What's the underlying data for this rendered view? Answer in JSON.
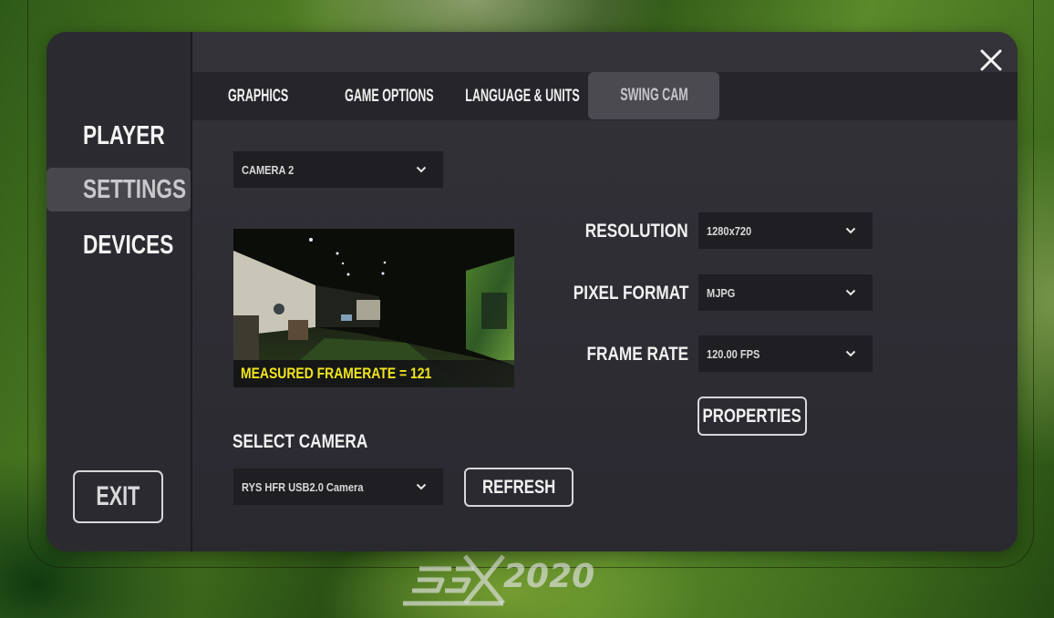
{
  "window": {
    "app_logo_text": "2020",
    "close_icon": "close-icon"
  },
  "sidebar": {
    "items": [
      {
        "label": "PLAYER",
        "active": false
      },
      {
        "label": "SETTINGS",
        "active": true
      },
      {
        "label": "DEVICES",
        "active": false
      }
    ],
    "exit_label": "EXIT"
  },
  "tabs": [
    {
      "label": "GRAPHICS",
      "active": false
    },
    {
      "label": "GAME OPTIONS",
      "active": false
    },
    {
      "label": "LANGUAGE & UNITS",
      "active": false
    },
    {
      "label": "SWING CAM",
      "active": true
    }
  ],
  "swing_cam": {
    "camera_slot": {
      "selected": "CAMERA 2"
    },
    "preview": {
      "measured_framerate_label": "MEASURED FRAMERATE = 121"
    },
    "resolution": {
      "label": "RESOLUTION",
      "selected": "1280x720"
    },
    "pixel_format": {
      "label": "PIXEL FORMAT",
      "selected": "MJPG"
    },
    "frame_rate": {
      "label": "FRAME RATE",
      "selected": "120.00 FPS"
    },
    "properties_label": "PROPERTIES",
    "select_camera": {
      "heading": "SELECT CAMERA",
      "selected": "RYS HFR USB2.0 Camera"
    },
    "refresh_label": "REFRESH"
  },
  "colors": {
    "panel_bg": "#2d2c33",
    "tabbar_bg": "#26252b",
    "active_item_bg": "#48474d",
    "dropdown_bg": "#1f1e22",
    "framerate_text": "#f2e51e",
    "text": "#f1f1f1"
  }
}
